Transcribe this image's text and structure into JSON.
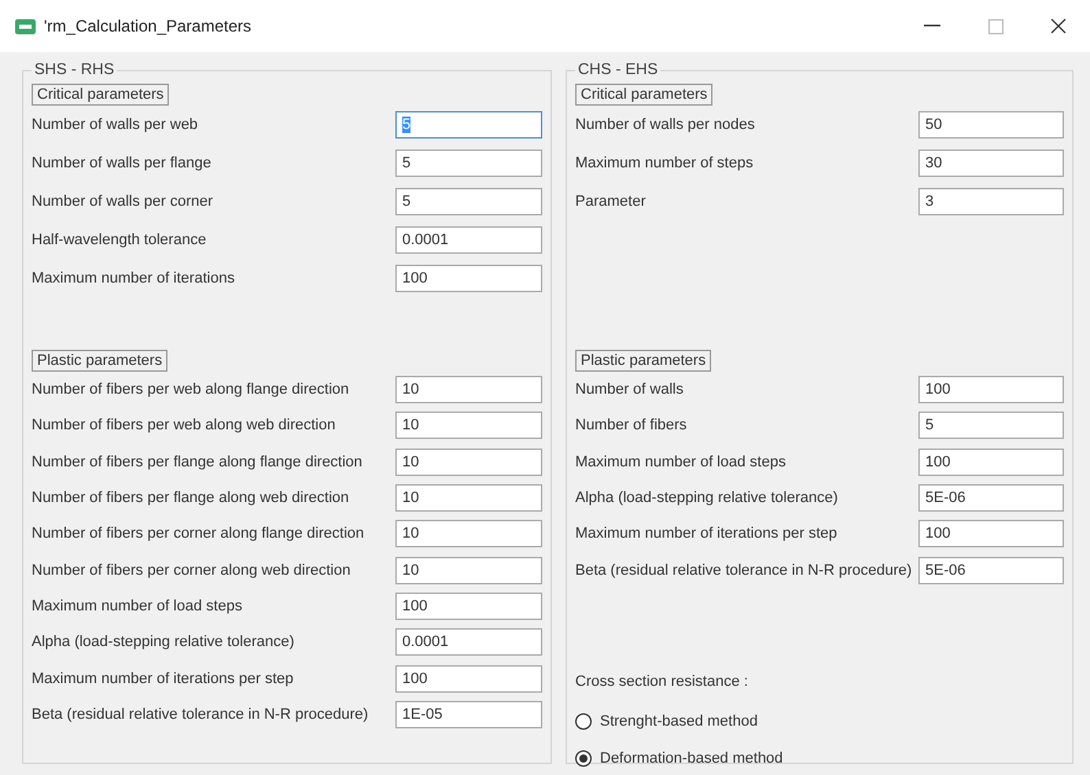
{
  "window": {
    "title": "'rm_Calculation_Parameters"
  },
  "groups": [
    {
      "title": "SHS - RHS",
      "sections": [
        {
          "title": "Critical parameters",
          "kind": "critical",
          "fields": [
            {
              "label": "Number of walls per web",
              "value": "5",
              "focused": true
            },
            {
              "label": "Number of walls per flange",
              "value": "5",
              "focused": false
            },
            {
              "label": "Number of walls per corner",
              "value": "5",
              "focused": false
            },
            {
              "label": "Half-wavelength tolerance",
              "value": "0.0001",
              "focused": false
            },
            {
              "label": "Maximum number of iterations",
              "value": "100",
              "focused": false
            }
          ]
        },
        {
          "title": "Plastic parameters",
          "kind": "plastic",
          "fields": [
            {
              "label": "Number of fibers per web along flange direction",
              "value": "10",
              "focused": false
            },
            {
              "label": "Number of fibers per web along web direction",
              "value": "10",
              "focused": false
            },
            {
              "label": "Number of fibers per flange along flange direction",
              "value": "10",
              "focused": false
            },
            {
              "label": "Number of fibers per flange along web direction",
              "value": "10",
              "focused": false
            },
            {
              "label": "Number of fibers per corner along flange direction",
              "value": "10",
              "focused": false
            },
            {
              "label": "Number of fibers per corner along web direction",
              "value": "10",
              "focused": false
            },
            {
              "label": "Maximum number of load steps",
              "value": "100",
              "focused": false
            },
            {
              "label": "Alpha (load-stepping relative tolerance)",
              "value": "0.0001",
              "focused": false
            },
            {
              "label": "Maximum number of iterations per step",
              "value": "100",
              "focused": false
            },
            {
              "label": "Beta (residual relative tolerance in N-R procedure)",
              "value": "1E-05",
              "focused": false
            }
          ]
        }
      ]
    },
    {
      "title": "CHS - EHS",
      "sections": [
        {
          "title": "Critical parameters",
          "kind": "critical",
          "fields": [
            {
              "label": "Number of walls per nodes",
              "value": "50",
              "focused": false
            },
            {
              "label": "Maximum number of steps",
              "value": "30",
              "focused": false
            },
            {
              "label": "Parameter",
              "value": "3",
              "focused": false
            }
          ]
        },
        {
          "title": "Plastic parameters",
          "kind": "plastic",
          "fields": [
            {
              "label": "Number of walls",
              "value": "100",
              "focused": false
            },
            {
              "label": "Number of fibers",
              "value": "5",
              "focused": false
            },
            {
              "label": "Maximum number of load steps",
              "value": "100",
              "focused": false
            },
            {
              "label": "Alpha (load-stepping relative tolerance)",
              "value": "5E-06",
              "focused": false
            },
            {
              "label": "Maximum number of iterations per step",
              "value": "100",
              "focused": false
            },
            {
              "label": "Beta (residual relative tolerance in N-R procedure)",
              "value": "5E-06",
              "focused": false
            }
          ]
        }
      ],
      "resistance": {
        "label": "Cross section resistance :",
        "options": [
          {
            "label": "Strenght-based method",
            "selected": false
          },
          {
            "label": "Deformation-based method",
            "selected": true
          }
        ]
      }
    }
  ]
}
